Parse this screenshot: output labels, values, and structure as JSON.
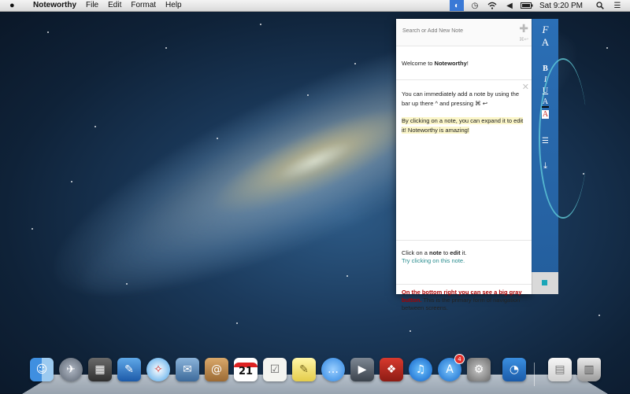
{
  "menubar": {
    "app_name": "Noteworthy",
    "menus": [
      "File",
      "Edit",
      "Format",
      "Help"
    ],
    "clock": "Sat 9:20 PM"
  },
  "search": {
    "placeholder": "Search or Add New Note",
    "shortcut": "⌘↩"
  },
  "notes": {
    "welcome_prefix": "Welcome to ",
    "welcome_bold": "Noteworthy",
    "welcome_suffix": "!",
    "add_text": "You can immediately add a note by using the bar up there ^ and pressing ⌘ ↩",
    "expand_text": "By clicking on a note, you can expand it to edit it! Noteworthy is amazing!",
    "edit_prefix": "Click on a ",
    "edit_bold1": "note",
    "edit_mid": " to ",
    "edit_bold2": "edit",
    "edit_suffix": " it.",
    "edit_teal": "Try clicking on this note.",
    "nav_red": "On the bottom right you can see a big gray button.",
    "nav_rest": " This is the primary form of navigation between screens."
  },
  "toolbar": {
    "font": "F",
    "size": "A",
    "bold": "B",
    "italic": "I",
    "underline": "U",
    "color": "A",
    "highlight": "A",
    "list": "☰",
    "save": "⤓"
  },
  "dock": {
    "calendar_day": "21",
    "appstore_badge": "4"
  },
  "colors": {
    "toolbar_blue": "#2b6fb6",
    "accent_teal": "#1aa6b7",
    "nav_red": "#aa0000"
  }
}
